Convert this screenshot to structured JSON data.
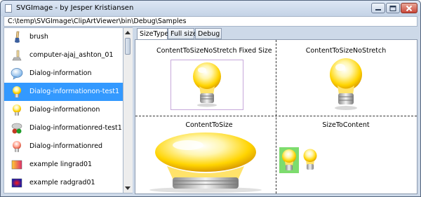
{
  "window": {
    "title": "SVGImage - by Jesper Kristiansen",
    "path": "C:\\temp\\SVGImage\\ClipArtViewer\\bin\\Debug\\Samples"
  },
  "list": {
    "items": [
      {
        "label": "brush",
        "icon": "brush-icon",
        "selected": false
      },
      {
        "label": "computer-ajaj_ashton_01",
        "icon": "computer-icon",
        "selected": false
      },
      {
        "label": "Dialog-information",
        "icon": "bubble-icon",
        "selected": false
      },
      {
        "label": "Dialog-informationon-test1",
        "icon": "bulb-icon",
        "selected": true
      },
      {
        "label": "Dialog-informationon",
        "icon": "bulb-icon",
        "selected": false
      },
      {
        "label": "Dialog-informationred-test1",
        "icon": "bulb-red-icon",
        "selected": false
      },
      {
        "label": "Dialog-informationred",
        "icon": "bulb-red-icon",
        "selected": false
      },
      {
        "label": "example lingrad01",
        "icon": "gradient-icon",
        "selected": false
      },
      {
        "label": "example radgrad01",
        "icon": "gradient-icon",
        "selected": false
      }
    ]
  },
  "tabs": [
    "SizeType",
    "Full size",
    "Debug"
  ],
  "active_tab": "SizeType",
  "cells": [
    {
      "title": "ContentToSizeNoStretch Fixed Size"
    },
    {
      "title": "ContentToSizeNoStretch"
    },
    {
      "title": "ContentToSize"
    },
    {
      "title": "SizeToContent"
    }
  ],
  "colors": {
    "selection": "#3399ff",
    "title_bar": "#dce6f4",
    "highlight_green": "#7ddc6e",
    "frame_border": "#c6a8da"
  }
}
